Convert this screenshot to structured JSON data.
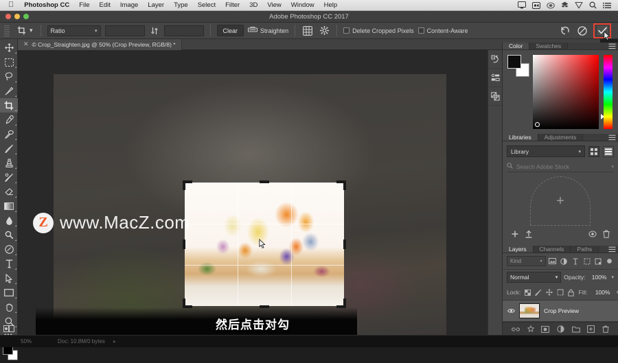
{
  "menubar": {
    "apple_icon": "apple-logo-icon",
    "app_name": "Photoshop CC",
    "items": [
      "File",
      "Edit",
      "Image",
      "Layer",
      "Type",
      "Select",
      "Filter",
      "3D",
      "View",
      "Window",
      "Help"
    ],
    "tray_icons": [
      "display-icon",
      "screen-record-icon",
      "creative-cloud-icon",
      "dropbox-icon",
      "shield-icon",
      "spotlight-search-icon",
      "notification-center-icon"
    ]
  },
  "titlebar": {
    "title": "Adobe Photoshop CC 2017",
    "close_label": "close",
    "minimize_label": "minimize",
    "zoom_label": "zoom"
  },
  "options_bar": {
    "tool_icon": "crop-tool-icon",
    "ratio_select": "Ratio",
    "width_value": "",
    "height_value": "",
    "swap_icon": "swap-dimensions-icon",
    "clear_label": "Clear",
    "straighten_icon": "straighten-icon",
    "straighten_label": "Straighten",
    "overlay_icon": "grid-overlay-icon",
    "settings_icon": "gear-icon",
    "delete_cropped_label": "Delete Cropped Pixels",
    "delete_cropped_checked": false,
    "content_aware_label": "Content-Aware",
    "content_aware_checked": false,
    "reset_icon": "reset-icon",
    "cancel_icon": "cancel-icon",
    "commit_icon": "checkmark-icon",
    "commit_highlight_color": "#ea4335"
  },
  "document_tab": {
    "close_icon": "close-icon",
    "title": "© Crop_Straighten.jpg @ 50% (Crop Preview, RGB/8) *"
  },
  "toolbar": {
    "tools": [
      {
        "name": "move-tool",
        "icon": "move-icon",
        "active": false
      },
      {
        "name": "marquee-tool",
        "icon": "rectangular-marquee-icon",
        "active": false
      },
      {
        "name": "lasso-tool",
        "icon": "lasso-icon",
        "active": false
      },
      {
        "name": "quick-selection-tool",
        "icon": "quick-selection-icon",
        "active": false
      },
      {
        "name": "crop-tool",
        "icon": "crop-icon",
        "active": true
      },
      {
        "name": "eyedropper-tool",
        "icon": "eyedropper-icon",
        "active": false
      },
      {
        "name": "healing-brush-tool",
        "icon": "healing-brush-icon",
        "active": false
      },
      {
        "name": "brush-tool",
        "icon": "brush-icon",
        "active": false
      },
      {
        "name": "clone-stamp-tool",
        "icon": "clone-stamp-icon",
        "active": false
      },
      {
        "name": "history-brush-tool",
        "icon": "history-brush-icon",
        "active": false
      },
      {
        "name": "eraser-tool",
        "icon": "eraser-icon",
        "active": false
      },
      {
        "name": "gradient-tool",
        "icon": "gradient-icon",
        "active": false
      },
      {
        "name": "blur-tool",
        "icon": "blur-droplet-icon",
        "active": false
      },
      {
        "name": "dodge-tool",
        "icon": "dodge-icon",
        "active": false
      },
      {
        "name": "pen-tool",
        "icon": "pen-icon",
        "active": false
      },
      {
        "name": "type-tool",
        "icon": "type-t-icon",
        "active": false
      },
      {
        "name": "path-selection-tool",
        "icon": "path-selection-arrow-icon",
        "active": false
      },
      {
        "name": "rectangle-tool",
        "icon": "rectangle-shape-icon",
        "active": false
      },
      {
        "name": "hand-tool",
        "icon": "hand-icon",
        "active": false
      },
      {
        "name": "zoom-tool",
        "icon": "magnifier-icon",
        "active": false
      }
    ],
    "more_tools_icon": "ellipsis-icon",
    "foreground_color": "#000000",
    "background_color": "#ffffff",
    "quick_mask_icon": "quick-mask-icon"
  },
  "canvas": {
    "watermark_logo_letter": "Z",
    "watermark_text": "www.MacZ.com",
    "crop_overlay": {
      "grid": "rule-of-thirds",
      "handles": 8
    },
    "subtitle": "然后点击对勾"
  },
  "statusbar": {
    "zoom": "50%",
    "doc_info": "Doc: 10.8M/0 bytes",
    "arrow_icon": "chevron-right-icon"
  },
  "rail": {
    "icons": [
      "history-panel-icon",
      "properties-panel-icon",
      "layer-comps-panel-icon"
    ]
  },
  "color_panel": {
    "tabs": [
      {
        "label": "Color",
        "active": true
      },
      {
        "label": "Swatches",
        "active": false
      }
    ],
    "menu_icon": "panel-menu-icon",
    "foreground_color": "#0d0d0d",
    "background_color": "#ffffff",
    "picker_hue": "#ff0000"
  },
  "libraries_panel": {
    "tabs": [
      {
        "label": "Libraries",
        "active": true
      },
      {
        "label": "Adjustments",
        "active": false
      }
    ],
    "menu_icon": "panel-menu-icon",
    "library_select": "Library",
    "grid_view_icon": "grid-view-icon",
    "list_view_icon": "list-view-icon",
    "search_icon": "search-icon",
    "search_placeholder": "Search Adobe Stock",
    "search_dropdown_icon": "chevron-down-icon",
    "drop_zone_icon": "plus-icon",
    "footer_icons": [
      "add-element-icon",
      "upload-icon",
      "sync-icon",
      "delete-icon"
    ]
  },
  "layers_panel": {
    "tabs": [
      {
        "label": "Layers",
        "active": true
      },
      {
        "label": "Channels",
        "active": false
      },
      {
        "label": "Paths",
        "active": false
      }
    ],
    "menu_icon": "panel-menu-icon",
    "filter_kind": "Kind",
    "filter_icons": [
      "filter-pixel-icon",
      "filter-adjustment-icon",
      "filter-type-icon",
      "filter-shape-icon",
      "filter-smart-object-icon",
      "filter-toggle-icon"
    ],
    "blend_mode": "Normal",
    "opacity_label": "Opacity:",
    "opacity_value": "100%",
    "lock_label": "Lock:",
    "lock_icons": [
      "lock-transparent-icon",
      "lock-image-icon",
      "lock-position-icon",
      "lock-artboard-icon",
      "lock-all-icon"
    ],
    "fill_label": "Fill:",
    "fill_value": "100%",
    "layers": [
      {
        "name": "Crop Preview",
        "visible": true,
        "eye_icon": "eye-icon"
      }
    ],
    "footer_icons": [
      "link-layers-icon",
      "layer-style-icon",
      "layer-mask-icon",
      "adjustment-layer-icon",
      "new-group-icon",
      "new-layer-icon",
      "delete-layer-icon"
    ]
  }
}
